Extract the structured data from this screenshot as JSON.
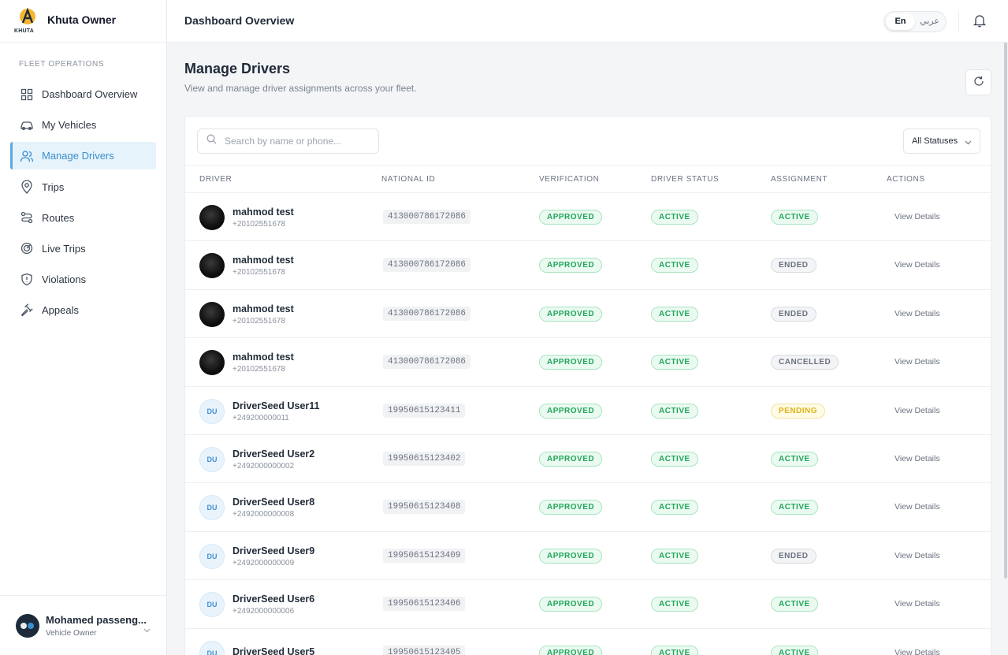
{
  "brand": {
    "logo_text": "KHUTA",
    "title": "Khuta Owner"
  },
  "sidebar": {
    "section_label": "FLEET OPERATIONS",
    "items": [
      {
        "label": "Dashboard Overview",
        "icon": "dashboard-icon"
      },
      {
        "label": "My Vehicles",
        "icon": "car-icon"
      },
      {
        "label": "Manage Drivers",
        "icon": "users-icon",
        "active": true
      },
      {
        "label": "Trips",
        "icon": "map-pin-icon"
      },
      {
        "label": "Routes",
        "icon": "route-icon"
      },
      {
        "label": "Live Trips",
        "icon": "radar-icon"
      },
      {
        "label": "Violations",
        "icon": "shield-alert-icon"
      },
      {
        "label": "Appeals",
        "icon": "gavel-icon"
      }
    ],
    "user": {
      "name": "Mohamed passeng...",
      "role": "Vehicle Owner"
    }
  },
  "topbar": {
    "title": "Dashboard Overview",
    "lang_en": "En",
    "lang_ar": "عربي",
    "active_lang": "En"
  },
  "page": {
    "title": "Manage Drivers",
    "subtitle": "View and manage driver assignments across your fleet."
  },
  "filters": {
    "search_placeholder": "Search by name or phone...",
    "status_select": "All Statuses"
  },
  "table": {
    "headers": {
      "driver": "DRIVER",
      "national_id": "NATIONAL ID",
      "verification": "VERIFICATION",
      "driver_status": "DRIVER STATUS",
      "assignment": "ASSIGNMENT",
      "actions": "ACTIONS"
    },
    "action_label": "View Details",
    "rows": [
      {
        "name": "mahmod test",
        "phone": "+20102551678",
        "avatar": "photo",
        "initials": "",
        "national_id": "413000786172086",
        "verification": "APPROVED",
        "status": "ACTIVE",
        "assignment": "ACTIVE",
        "assignment_tone": "g"
      },
      {
        "name": "mahmod test",
        "phone": "+20102551678",
        "avatar": "photo",
        "initials": "",
        "national_id": "413000786172086",
        "verification": "APPROVED",
        "status": "ACTIVE",
        "assignment": "ENDED",
        "assignment_tone": "gr"
      },
      {
        "name": "mahmod test",
        "phone": "+20102551678",
        "avatar": "photo",
        "initials": "",
        "national_id": "413000786172086",
        "verification": "APPROVED",
        "status": "ACTIVE",
        "assignment": "ENDED",
        "assignment_tone": "gr"
      },
      {
        "name": "mahmod test",
        "phone": "+20102551678",
        "avatar": "photo",
        "initials": "",
        "national_id": "413000786172086",
        "verification": "APPROVED",
        "status": "ACTIVE",
        "assignment": "CANCELLED",
        "assignment_tone": "gr"
      },
      {
        "name": "DriverSeed User11",
        "phone": "+249200000011",
        "avatar": "initials",
        "initials": "DU",
        "national_id": "19950615123411",
        "verification": "APPROVED",
        "status": "ACTIVE",
        "assignment": "PENDING",
        "assignment_tone": "y"
      },
      {
        "name": "DriverSeed User2",
        "phone": "+2492000000002",
        "avatar": "initials",
        "initials": "DU",
        "national_id": "19950615123402",
        "verification": "APPROVED",
        "status": "ACTIVE",
        "assignment": "ACTIVE",
        "assignment_tone": "g"
      },
      {
        "name": "DriverSeed User8",
        "phone": "+2492000000008",
        "avatar": "initials",
        "initials": "DU",
        "national_id": "19950615123408",
        "verification": "APPROVED",
        "status": "ACTIVE",
        "assignment": "ACTIVE",
        "assignment_tone": "g"
      },
      {
        "name": "DriverSeed User9",
        "phone": "+2492000000009",
        "avatar": "initials",
        "initials": "DU",
        "national_id": "19950615123409",
        "verification": "APPROVED",
        "status": "ACTIVE",
        "assignment": "ENDED",
        "assignment_tone": "gr"
      },
      {
        "name": "DriverSeed User6",
        "phone": "+2492000000006",
        "avatar": "initials",
        "initials": "DU",
        "national_id": "19950615123406",
        "verification": "APPROVED",
        "status": "ACTIVE",
        "assignment": "ACTIVE",
        "assignment_tone": "g"
      },
      {
        "name": "DriverSeed User5",
        "phone": "",
        "avatar": "initials",
        "initials": "DU",
        "national_id": "19950615123405",
        "verification": "APPROVED",
        "status": "ACTIVE",
        "assignment": "ACTIVE",
        "assignment_tone": "g"
      }
    ]
  },
  "colors": {
    "accent": "#3b8fd0",
    "success": "#22a55b",
    "warning": "#e0b418",
    "muted": "#6b7280"
  }
}
